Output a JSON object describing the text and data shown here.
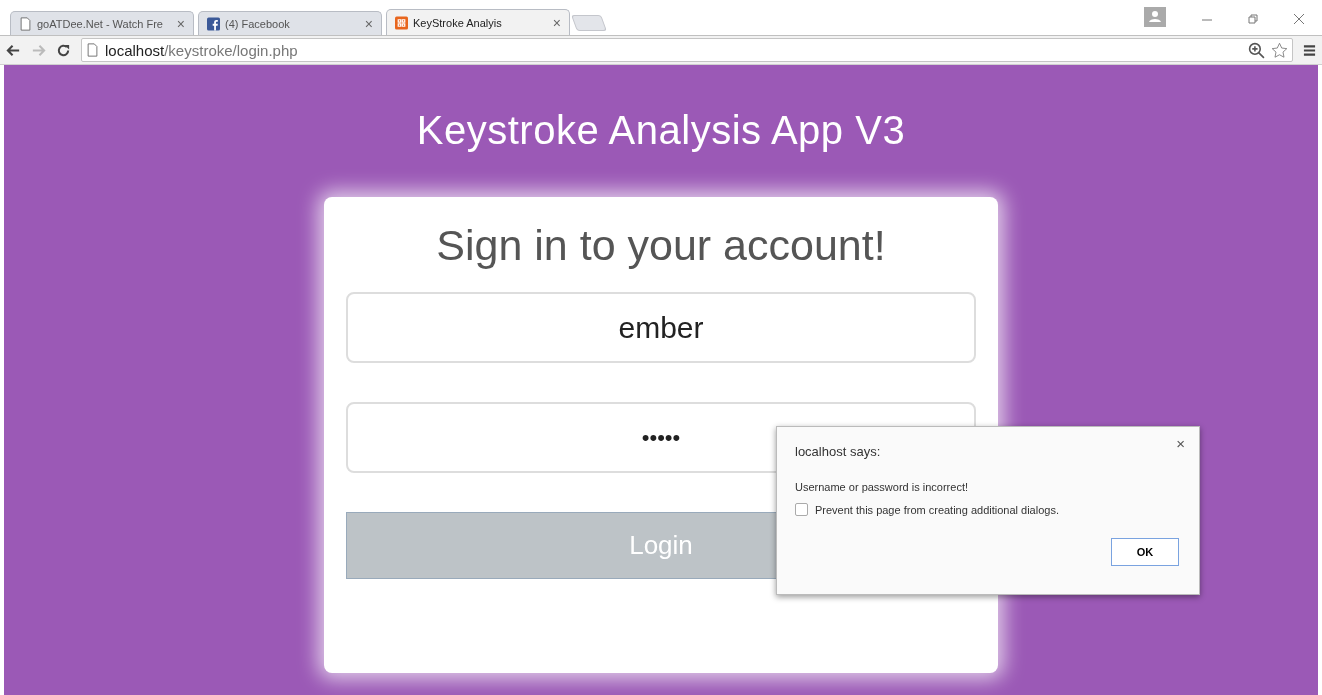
{
  "browser": {
    "tabs": [
      {
        "kind": "page",
        "title": "goATDee.Net - Watch Fre",
        "close": "×",
        "selected": false
      },
      {
        "kind": "facebook",
        "title": "(4) Facebook",
        "close": "×",
        "selected": false
      },
      {
        "kind": "app",
        "title": "KeyStroke Analyis",
        "close": "×",
        "selected": true
      }
    ],
    "address": {
      "host": "localhost",
      "path": "/keystroke/login.php"
    }
  },
  "page": {
    "title": "Keystroke Analysis App V3",
    "heading": "Sign in to your account!",
    "fields": [
      {
        "kind": "text",
        "value": "ember"
      },
      {
        "kind": "password",
        "value": "•••••"
      }
    ],
    "login_button": "Login"
  },
  "dialog": {
    "title": "localhost says:",
    "close": "×",
    "message": "Username or password is incorrect!",
    "checkbox": {
      "label": "Prevent this page from creating additional dialogs.",
      "checked": false
    },
    "ok_button": "OK"
  }
}
